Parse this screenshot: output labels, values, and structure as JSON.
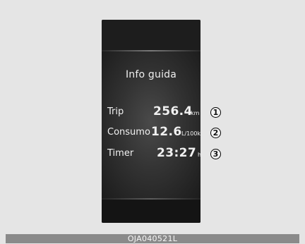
{
  "display": {
    "title": "Info guida",
    "rows": [
      {
        "label": "Trip",
        "value": "256.4",
        "unit": "km",
        "callout": "1"
      },
      {
        "label": "Consumo",
        "value": "12.6",
        "unit": "L/100k",
        "callout": "2"
      },
      {
        "label": "Timer",
        "value": "23:27",
        "unit": "h",
        "callout": "3"
      }
    ]
  },
  "footer": {
    "code": "OJA040521L"
  }
}
